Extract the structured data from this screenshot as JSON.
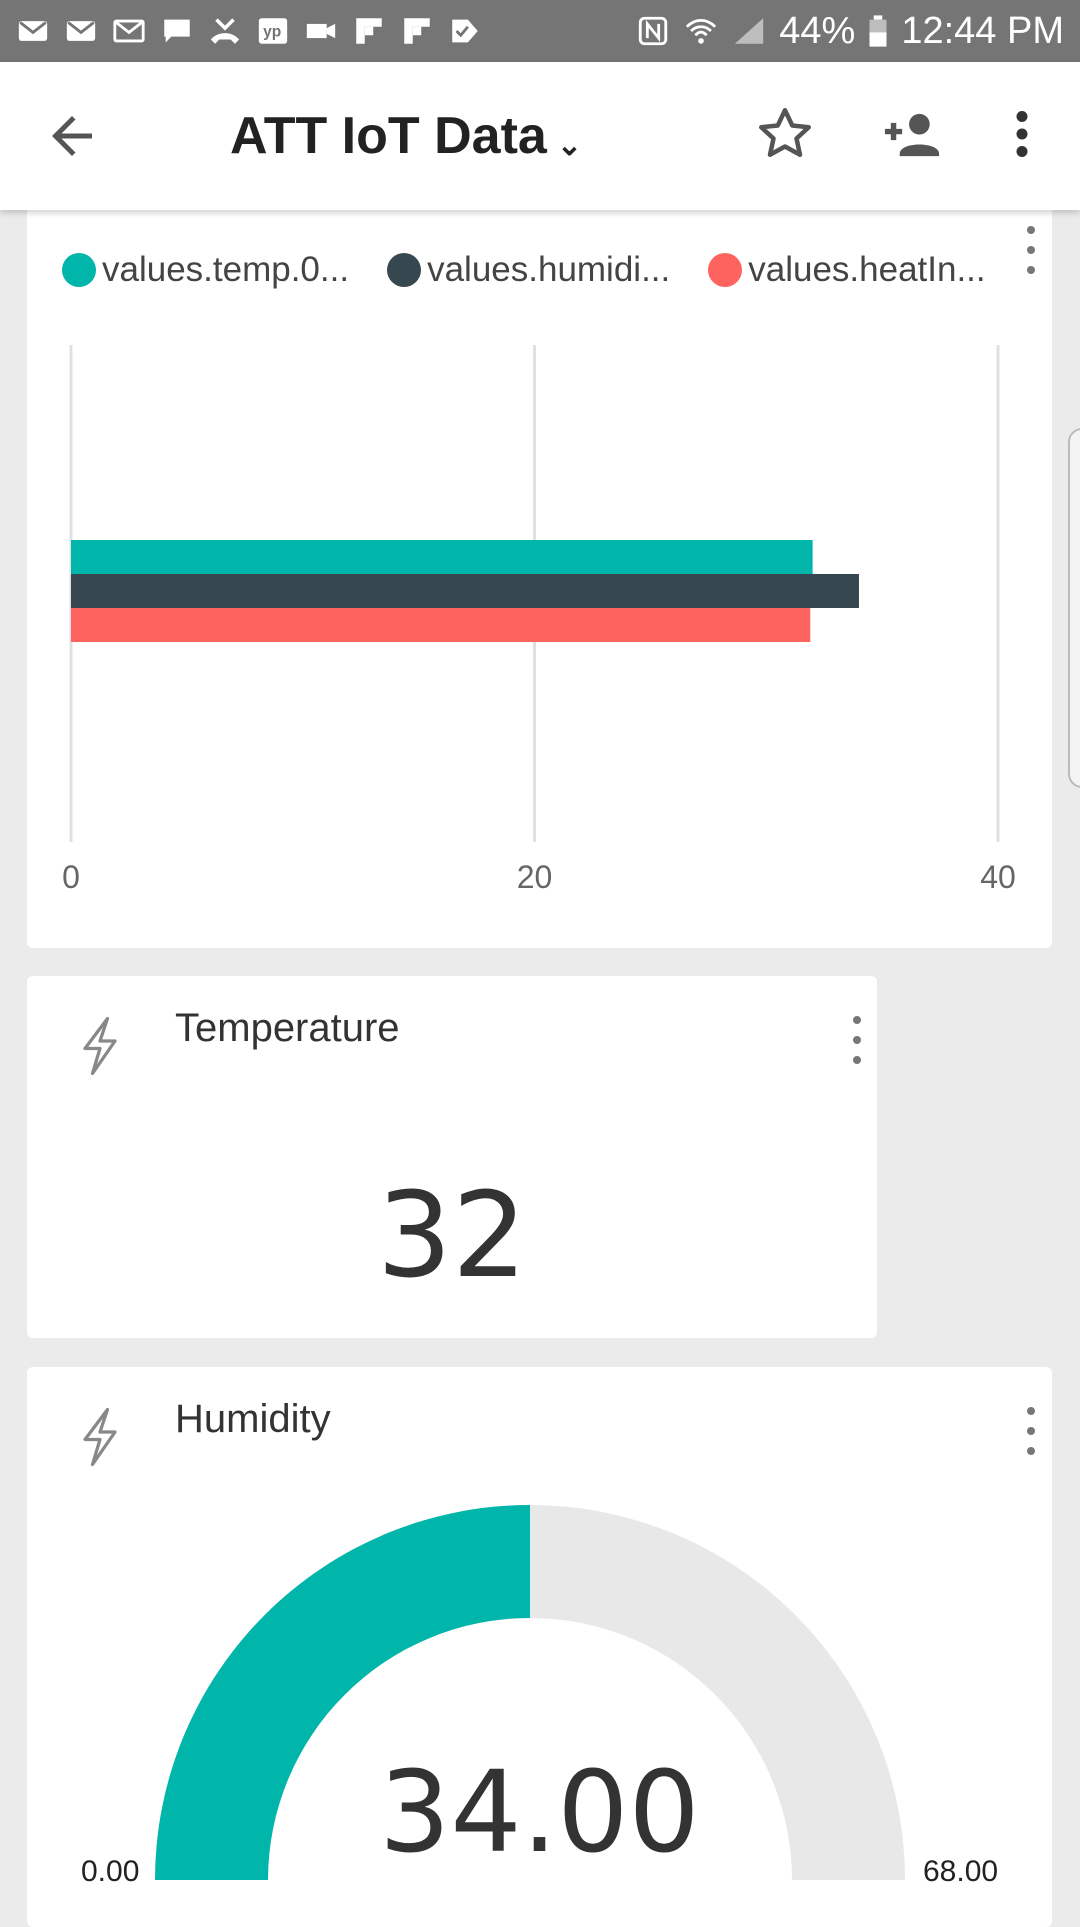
{
  "status_bar": {
    "battery": "44%",
    "time": "12:44 PM"
  },
  "app_bar": {
    "title": "ATT IoT Data"
  },
  "bar_chart": {
    "legend": [
      {
        "label": "values.temp.0...",
        "color": "#00b5a9"
      },
      {
        "label": "values.humidi...",
        "color": "#37474f"
      },
      {
        "label": "values.heatIn...",
        "color": "#ff6360"
      }
    ],
    "ticks": [
      "0",
      "20",
      "40"
    ]
  },
  "chart_data": {
    "type": "bar",
    "orientation": "horizontal",
    "xlim": [
      0,
      40
    ],
    "grid": true,
    "legend_position": "top",
    "series": [
      {
        "name": "values.temp.0...",
        "values": [
          32
        ],
        "color": "#00b5a9"
      },
      {
        "name": "values.humidi...",
        "values": [
          34
        ],
        "color": "#37474f"
      },
      {
        "name": "values.heatIn...",
        "values": [
          31.9
        ],
        "color": "#ff6360"
      }
    ],
    "x_ticks": [
      "0",
      "20",
      "40"
    ]
  },
  "temperature_card": {
    "title": "Temperature",
    "value": "32"
  },
  "humidity_card": {
    "title": "Humidity",
    "value": "34.00",
    "min_label": "0.00",
    "max_label": "68.00",
    "fraction": 0.5,
    "fill_color": "#00b5a9",
    "track_color": "#e8e8e8"
  }
}
